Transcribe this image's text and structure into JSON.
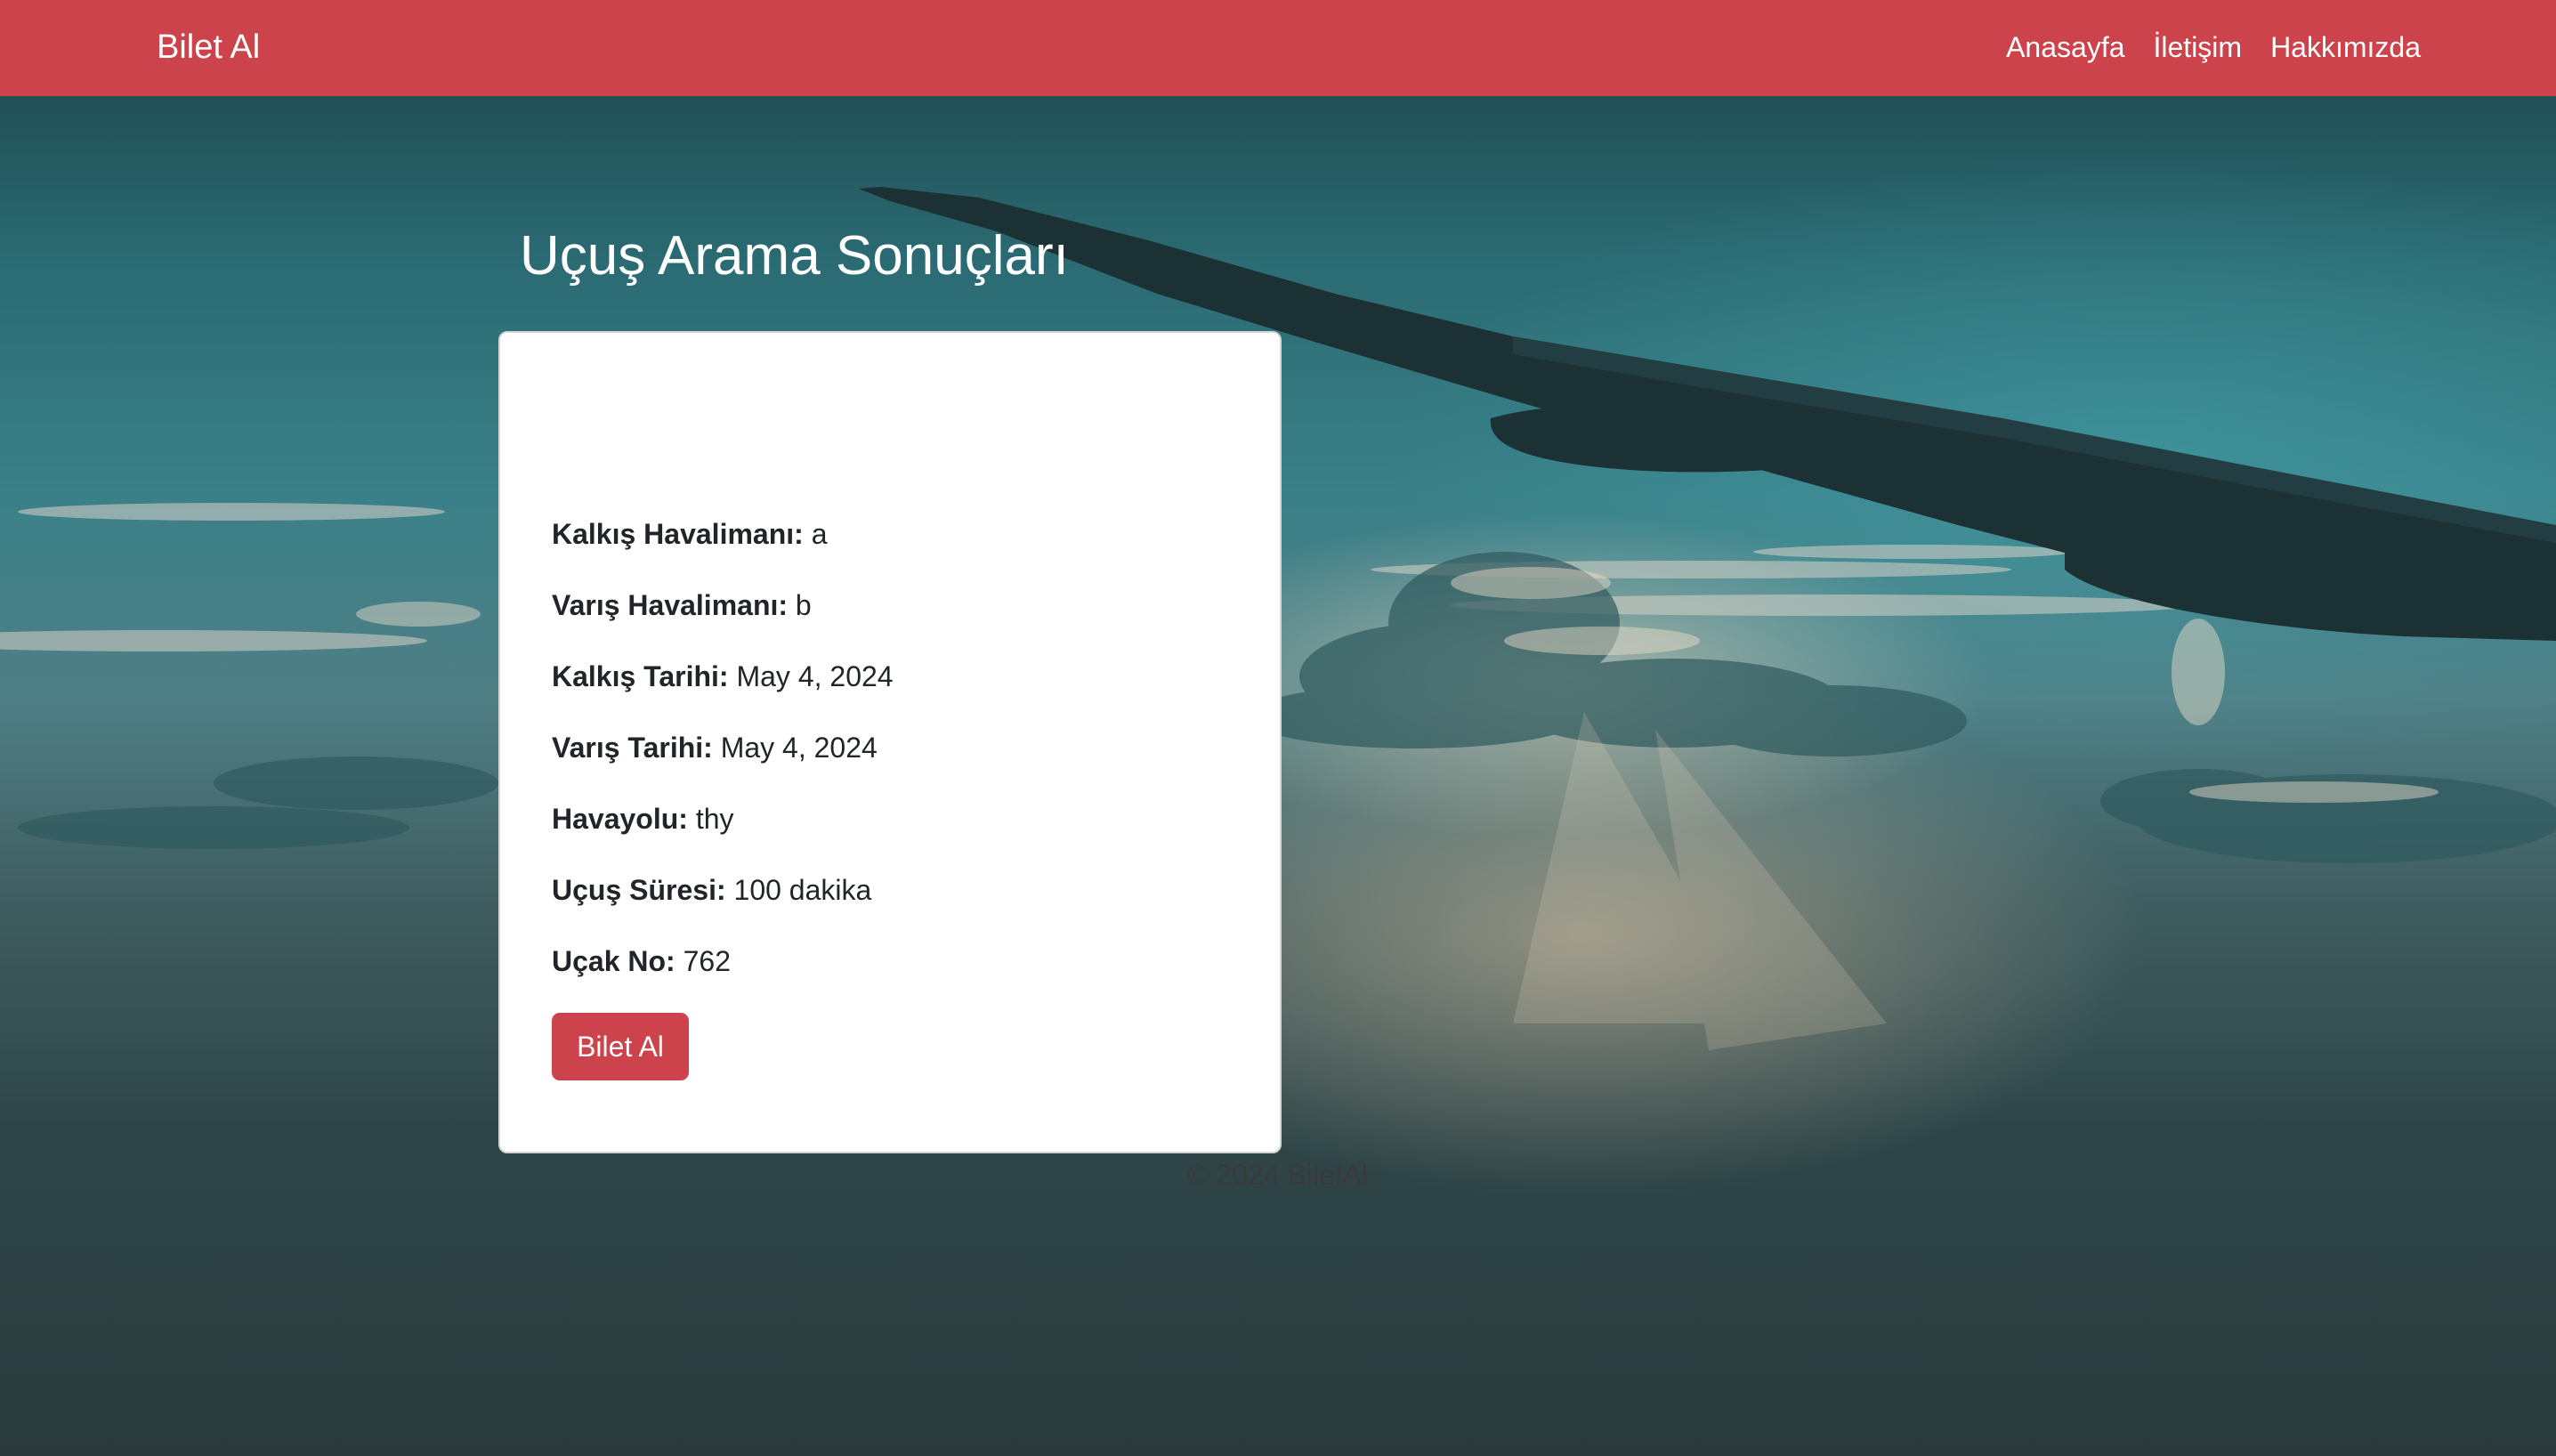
{
  "navbar": {
    "brand": "Bilet Al",
    "links": [
      {
        "label": "Anasayfa"
      },
      {
        "label": "İletişim"
      },
      {
        "label": "Hakkımızda"
      }
    ],
    "bg_color": "#cd434b"
  },
  "main": {
    "title": "Uçuş Arama Sonuçları",
    "flight": {
      "departure_airport": {
        "label": "Kalkış Havalimanı:",
        "value": "a"
      },
      "arrival_airport": {
        "label": "Varış Havalimanı:",
        "value": "b"
      },
      "departure_date": {
        "label": "Kalkış Tarihi:",
        "value": "May 4, 2024"
      },
      "arrival_date": {
        "label": "Varış Tarihi:",
        "value": "May 4, 2024"
      },
      "airline": {
        "label": "Havayolu:",
        "value": "thy"
      },
      "duration": {
        "label": "Uçuş Süresi:",
        "value": "100 dakika"
      },
      "plane_no": {
        "label": "Uçak No:",
        "value": "762"
      }
    },
    "buy_button": "Bilet Al"
  },
  "footer": {
    "text": "© 2024 BiletAl"
  },
  "theme": {
    "accent": "#cd434b",
    "card_bg": "#ffffff",
    "text_color": "#212529"
  }
}
